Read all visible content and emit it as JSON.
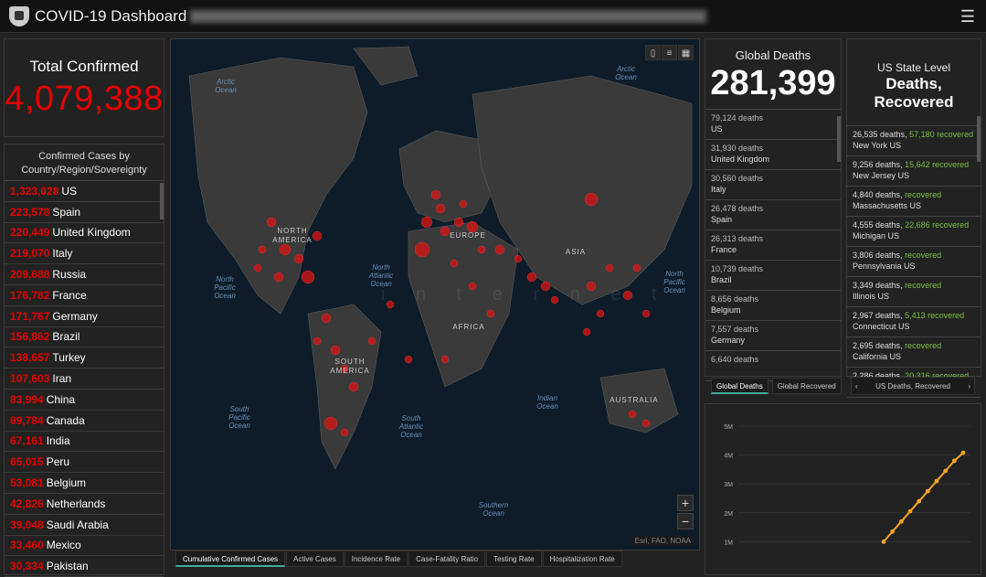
{
  "header": {
    "title": "COVID-19 Dashboard",
    "menu_icon": "hamburger-icon"
  },
  "total": {
    "label": "Total Confirmed",
    "value": "4,079,388"
  },
  "country_list": {
    "header": "Confirmed Cases by Country/Region/Sovereignty",
    "rows": [
      {
        "value": "1,323,028",
        "name": "US"
      },
      {
        "value": "223,578",
        "name": "Spain"
      },
      {
        "value": "220,449",
        "name": "United Kingdom"
      },
      {
        "value": "219,070",
        "name": "Italy"
      },
      {
        "value": "209,688",
        "name": "Russia"
      },
      {
        "value": "176,782",
        "name": "France"
      },
      {
        "value": "171,767",
        "name": "Germany"
      },
      {
        "value": "156,862",
        "name": "Brazil"
      },
      {
        "value": "138,657",
        "name": "Turkey"
      },
      {
        "value": "107,603",
        "name": "Iran"
      },
      {
        "value": "83,994",
        "name": "China"
      },
      {
        "value": "69,784",
        "name": "Canada"
      },
      {
        "value": "67,161",
        "name": "India"
      },
      {
        "value": "65,015",
        "name": "Peru"
      },
      {
        "value": "53,081",
        "name": "Belgium"
      },
      {
        "value": "42,826",
        "name": "Netherlands"
      },
      {
        "value": "39,048",
        "name": "Saudi Arabia"
      },
      {
        "value": "33,460",
        "name": "Mexico"
      },
      {
        "value": "30,334",
        "name": "Pakistan"
      }
    ]
  },
  "map": {
    "oceans": {
      "arctic_left": "Arctic Ocean",
      "arctic_right": "Arctic Ocean",
      "north_pacific_left": "North Pacific Ocean",
      "north_atlantic": "North Atlantic Ocean",
      "north_pacific_right": "North Pacific Ocean",
      "south_pacific": "South Pacific Ocean",
      "south_atlantic": "South Atlantic Ocean",
      "indian": "Indian Ocean",
      "southern": "Southern Ocean"
    },
    "continents": {
      "north_america": "NORTH AMERICA",
      "europe": "EUROPE",
      "asia": "ASIA",
      "africa": "AFRICA",
      "south_america": "SOUTH AMERICA",
      "australia": "AUSTRALIA"
    },
    "watermark": "i n t e r n e t",
    "attribution": "Esri, FAO, NOAA",
    "zoom_in": "+",
    "zoom_out": "−",
    "tabs": [
      "Cumulative Confirmed Cases",
      "Active Cases",
      "Incidence Rate",
      "Case-Fatality Ratio",
      "Testing Rate",
      "Hospitalization Rate"
    ]
  },
  "global_deaths": {
    "title": "Global Deaths",
    "value": "281,399",
    "rows": [
      {
        "deaths": "79,124 deaths",
        "name": "US"
      },
      {
        "deaths": "31,930 deaths",
        "name": "United Kingdom"
      },
      {
        "deaths": "30,560 deaths",
        "name": "Italy"
      },
      {
        "deaths": "26,478 deaths",
        "name": "Spain"
      },
      {
        "deaths": "26,313 deaths",
        "name": "France"
      },
      {
        "deaths": "10,739 deaths",
        "name": "Brazil"
      },
      {
        "deaths": "8,656 deaths",
        "name": "Belgium"
      },
      {
        "deaths": "7,557 deaths",
        "name": "Germany"
      },
      {
        "deaths": "6,640 deaths",
        "name": ""
      }
    ],
    "tabs": [
      "Global Deaths",
      "Global Recovered"
    ]
  },
  "us_state": {
    "title": "US State Level",
    "subtitle": "Deaths, Recovered",
    "rows": [
      {
        "deaths": "26,535 deaths,",
        "recovered": "57,180 recovered",
        "name": "New York US"
      },
      {
        "deaths": "9,256 deaths,",
        "recovered": "15,642 recovered",
        "name": "New Jersey US"
      },
      {
        "deaths": "4,840 deaths,",
        "recovered": "recovered",
        "name": "Massachusetts US"
      },
      {
        "deaths": "4,555 deaths,",
        "recovered": "22,686 recovered",
        "name": "Michigan US"
      },
      {
        "deaths": "3,806 deaths,",
        "recovered": "recovered",
        "name": "Pennsylvania US"
      },
      {
        "deaths": "3,349 deaths,",
        "recovered": "recovered",
        "name": "Illinois US"
      },
      {
        "deaths": "2,967 deaths,",
        "recovered": "5,413 recovered",
        "name": "Connecticut US"
      },
      {
        "deaths": "2,695 deaths,",
        "recovered": "recovered",
        "name": "California US"
      },
      {
        "deaths": "2,286 deaths,",
        "recovered": "20,316 recovered",
        "name": ""
      }
    ],
    "nav_label": "US Deaths, Recovered",
    "nav_prev": "‹",
    "nav_next": "›"
  },
  "chart_data": {
    "type": "line",
    "y_ticks": [
      "5M",
      "4M",
      "3M",
      "2M",
      "1M"
    ],
    "ylim": [
      0,
      5000000
    ],
    "series": [
      {
        "values": [
          1000000,
          1350000,
          1700000,
          2050000,
          2400000,
          2750000,
          3100000,
          3450000,
          3800000,
          4079388
        ]
      }
    ],
    "line_color": "#f5a623"
  }
}
